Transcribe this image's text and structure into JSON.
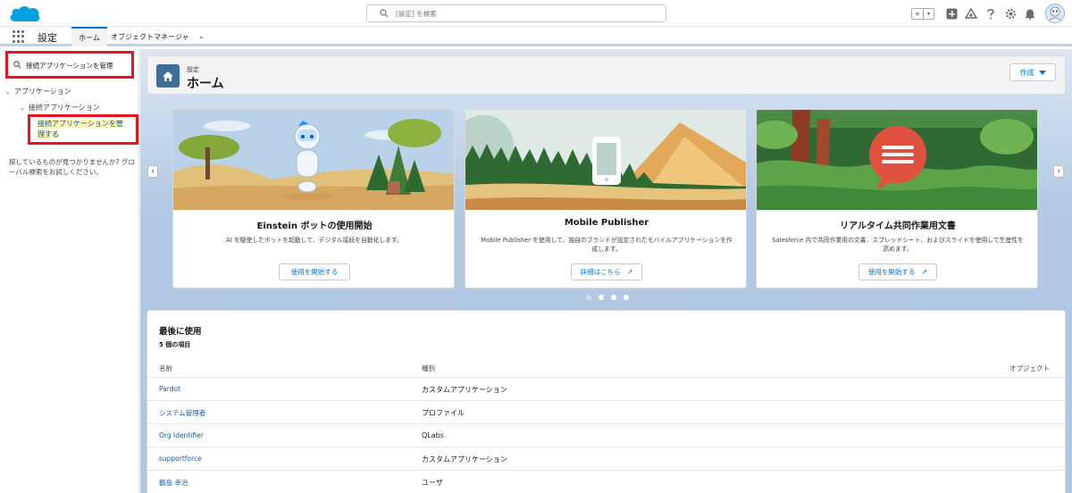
{
  "header": {
    "search_placeholder": "[設定] を検索",
    "favorites_star": "★",
    "favorites_menu": "▾"
  },
  "context": {
    "app_name": "設定",
    "tab_home": "ホーム",
    "tab_object_manager": "オブジェクトマネージャ"
  },
  "sidebar": {
    "quick_find_value": "接続アプリケーションを管理",
    "tree_root": "アプリケーション",
    "tree_child": "接続アプリケーション",
    "tree_leaf": "接続アプリケーションを管理する",
    "not_found_text": "探しているものが見つかりませんか? グローバル検索をお試しください。"
  },
  "page_header": {
    "kicker": "設定",
    "title": "ホーム",
    "create_button": "作成"
  },
  "carousel": {
    "cards": [
      {
        "title": "Einstein ボットの使用開始",
        "description": "AI を駆使したボットを起動して、デジタル接続を自動化します。",
        "button": "使用を開始する",
        "external": ""
      },
      {
        "title": "Mobile Publisher",
        "description": "Mobile Publisher を使用して、独自のブランドが設定されたモバイルアプリケーションを作成します。",
        "button": "詳細はこちら",
        "external": "↗"
      },
      {
        "title": "リアルタイム共同作業用文書",
        "description": "Salesforce 内で共同作業用の文書、スプレッドシート、およびスライドを使用して生産性を高めます。",
        "button": "使用を開始する",
        "external": "↗"
      }
    ],
    "active_page": 2,
    "page_count": 4
  },
  "recent": {
    "title": "最後に使用",
    "count": "5 個の項目",
    "columns": [
      "名前",
      "種別",
      "オブジェクト"
    ],
    "rows": [
      {
        "name": "Pardot",
        "type": "カスタムアプリケーション"
      },
      {
        "name": "システム管理者",
        "type": "プロファイル"
      },
      {
        "name": "Org Identifier",
        "type": "QLabs"
      },
      {
        "name": "supportforce",
        "type": "カスタムアプリケーション"
      },
      {
        "name": "鶴島 幸治",
        "type": "ユーザ"
      }
    ]
  },
  "colors": {
    "brand_blue": "#0176d3",
    "highlight_red": "#e8131e",
    "link_blue": "#0b5cab"
  }
}
